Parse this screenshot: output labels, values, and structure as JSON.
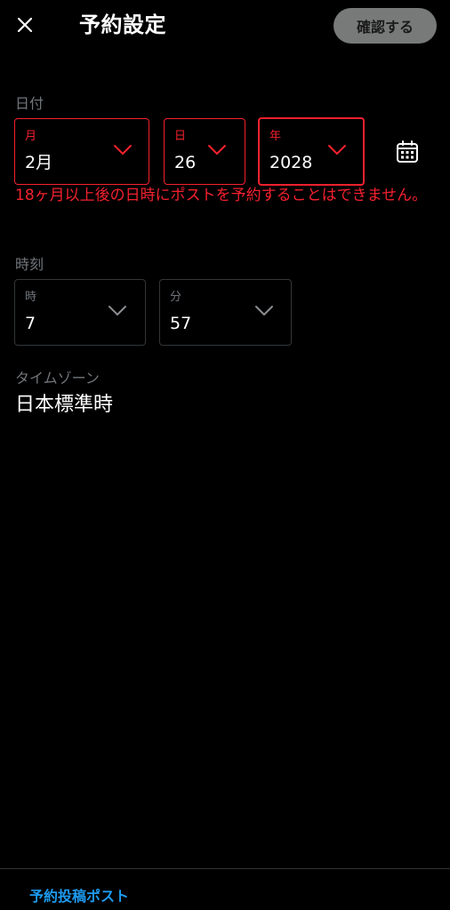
{
  "header": {
    "title": "予約設定",
    "confirm_label": "確認する"
  },
  "date": {
    "section_label": "日付",
    "month": {
      "label": "月",
      "value": "2月"
    },
    "day": {
      "label": "日",
      "value": "26"
    },
    "year": {
      "label": "年",
      "value": "2028"
    },
    "error": "18ヶ月以上後の日時にポストを予約することはできません。"
  },
  "time": {
    "section_label": "時刻",
    "hour": {
      "label": "時",
      "value": "7"
    },
    "minute": {
      "label": "分",
      "value": "57"
    }
  },
  "timezone": {
    "label": "タイムゾーン",
    "value": "日本標準時"
  },
  "footer": {
    "link_label": "予約投稿ポスト"
  },
  "colors": {
    "background": "#000000",
    "error": "#f4212e",
    "link": "#1d9bf0",
    "confirm_bg": "#787a7a",
    "muted_text": "#71767b",
    "border": "#333639"
  },
  "icons": [
    "close-icon",
    "chevron-down-icon",
    "calendar-icon"
  ]
}
